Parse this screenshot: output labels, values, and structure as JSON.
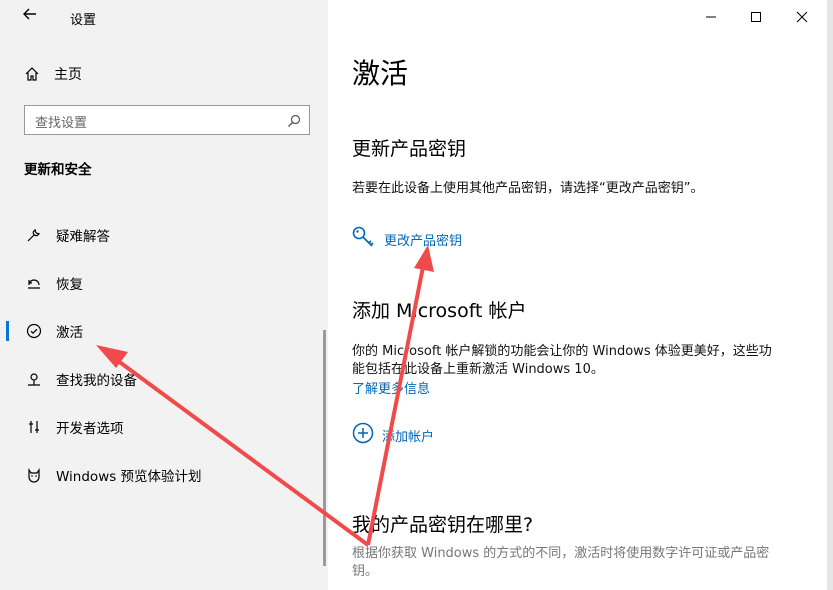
{
  "window": {
    "title": "设置",
    "back_icon": "back-arrow-icon",
    "controls": {
      "minimize": "minimize-icon",
      "maximize": "maximize-icon",
      "close": "close-icon"
    }
  },
  "sidebar": {
    "home_label": "主页",
    "search_placeholder": "查找设置",
    "section_title": "更新和安全",
    "items": [
      {
        "label": "疑难解答",
        "icon": "wrench-icon"
      },
      {
        "label": "恢复",
        "icon": "recovery-icon"
      },
      {
        "label": "激活",
        "icon": "check-circle-icon",
        "active": true
      },
      {
        "label": "查找我的设备",
        "icon": "find-device-icon"
      },
      {
        "label": "开发者选项",
        "icon": "developer-tools-icon"
      },
      {
        "label": "Windows 预览体验计划",
        "icon": "insider-cat-icon"
      }
    ]
  },
  "main": {
    "title": "激活",
    "update_key": {
      "heading": "更新产品密钥",
      "desc": "若要在此设备上使用其他产品密钥，请选择“更改产品密钥”。",
      "link": "更改产品密钥"
    },
    "ms_account": {
      "heading": "添加 Microsoft 帐户",
      "desc_line1": "你的 Microsoft 帐户解锁的功能会让你的 Windows 体验更美好，这些功",
      "desc_line2": "能包括在此设备上重新激活 Windows 10。",
      "learn_more": "了解更多信息",
      "add_link": "添加帐户"
    },
    "where_key": {
      "heading": "我的产品密钥在哪里?",
      "desc_line1": "根据你获取 Windows 的方式的不同，激活时将使用数字许可证或产品密",
      "desc_line2": "钥。"
    }
  },
  "colors": {
    "accent": "#0078d7",
    "link": "#0067b8",
    "annotation_arrow": "#f04a4a",
    "sidebar_bg": "#f2f2f2"
  }
}
